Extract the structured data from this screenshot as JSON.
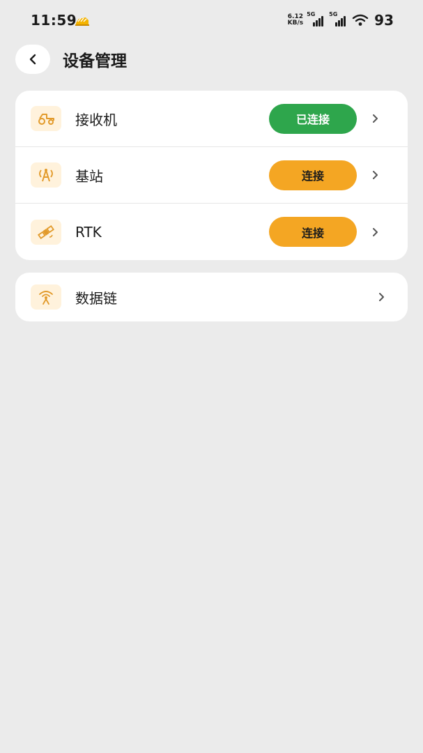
{
  "status_bar": {
    "time": "11:59",
    "net_speed_value": "6.12",
    "net_speed_unit": "KB/s",
    "sim1_tag": "5G",
    "sim2_tag": "5G",
    "battery": "93"
  },
  "header": {
    "title": "设备管理"
  },
  "devices": [
    {
      "label": "接收机",
      "action": "已连接",
      "status": "connected",
      "icon": "tractor-icon"
    },
    {
      "label": "基站",
      "action": "连接",
      "status": "disconnected",
      "icon": "antenna-icon"
    },
    {
      "label": "RTK",
      "action": "连接",
      "status": "disconnected",
      "icon": "satellite-icon"
    }
  ],
  "data_link": {
    "label": "数据链",
    "icon": "radio-tower-icon"
  },
  "colors": {
    "background": "#ebebeb",
    "card": "#ffffff",
    "connected": "#2ea64c",
    "connect": "#f4a623",
    "icon_bg": "#fff2dc",
    "icon_fg": "#e29a2a"
  }
}
